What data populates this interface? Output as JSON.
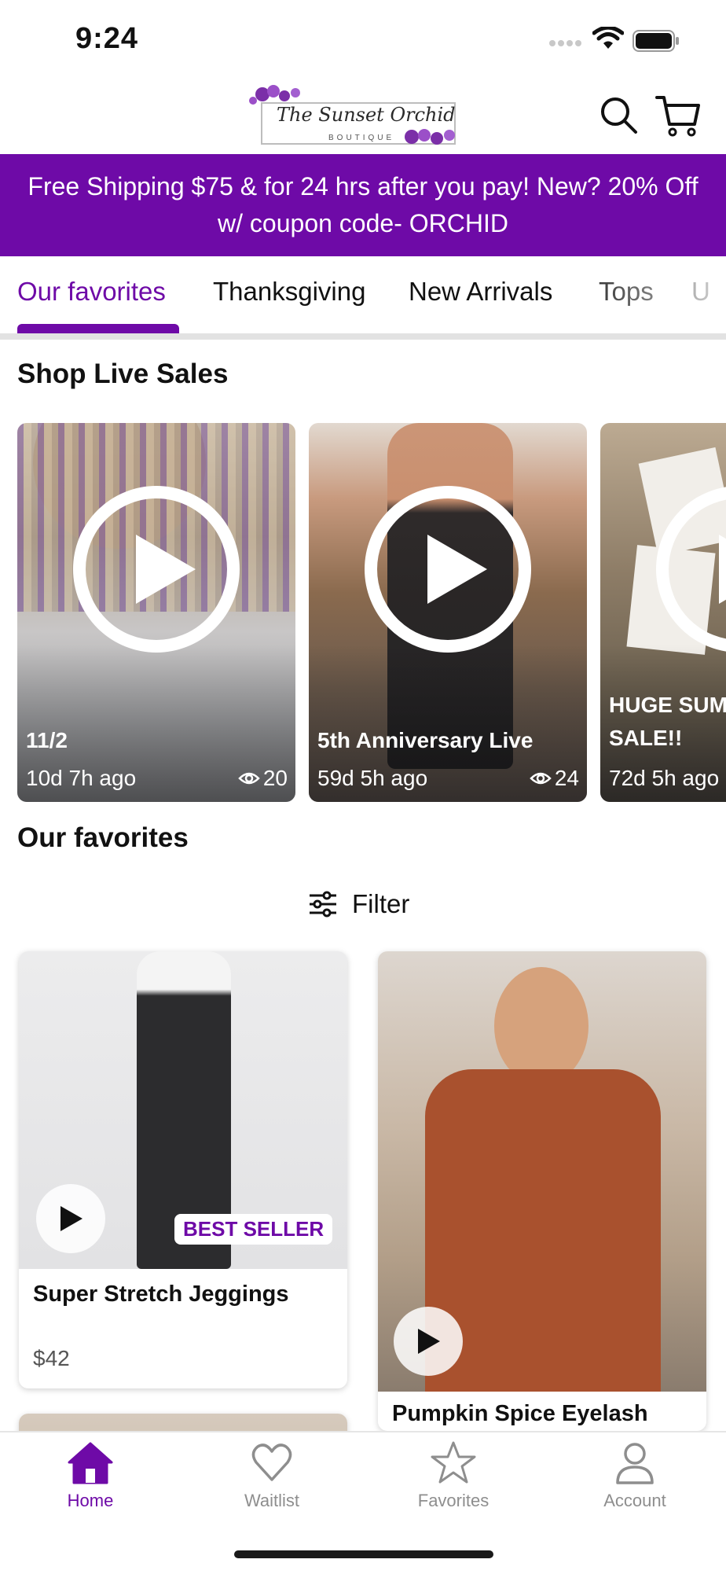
{
  "status_bar": {
    "time": "9:24"
  },
  "header": {
    "logo_text": "The Sunset Orchid",
    "logo_sub": "BOUTIQUE",
    "search_icon": "search-icon",
    "cart_icon": "cart-icon"
  },
  "promo": {
    "text": "Free Shipping $75 & for 24 hrs after you pay! New? 20% Off w/ coupon code- ORCHID"
  },
  "tabs": [
    {
      "label": "Our favorites",
      "active": true
    },
    {
      "label": "Thanksgiving"
    },
    {
      "label": "New Arrivals"
    },
    {
      "label": "Tops"
    },
    {
      "label": "U"
    }
  ],
  "live": {
    "title": "Shop Live Sales",
    "cards": [
      {
        "title": "11/2",
        "ago": "10d 7h ago",
        "views": "20"
      },
      {
        "title": "5th Anniversary Live",
        "ago": "59d 5h ago",
        "views": "24"
      },
      {
        "title_line1": "HUGE SUM",
        "title_line2": "SALE!!",
        "ago": "72d 5h ago"
      }
    ]
  },
  "favorites": {
    "title": "Our favorites",
    "filter_label": "Filter",
    "products": [
      {
        "name": "Super Stretch Jeggings",
        "price": "$42",
        "badge": "BEST SELLER"
      },
      {
        "name": "Pumpkin Spice Eyelash"
      }
    ]
  },
  "tabbar": {
    "items": [
      {
        "label": "Home",
        "icon": "home-icon",
        "active": true
      },
      {
        "label": "Waitlist",
        "icon": "heart-icon"
      },
      {
        "label": "Favorites",
        "icon": "star-icon"
      },
      {
        "label": "Account",
        "icon": "person-icon"
      }
    ]
  },
  "colors": {
    "accent": "#6e0aa7"
  }
}
